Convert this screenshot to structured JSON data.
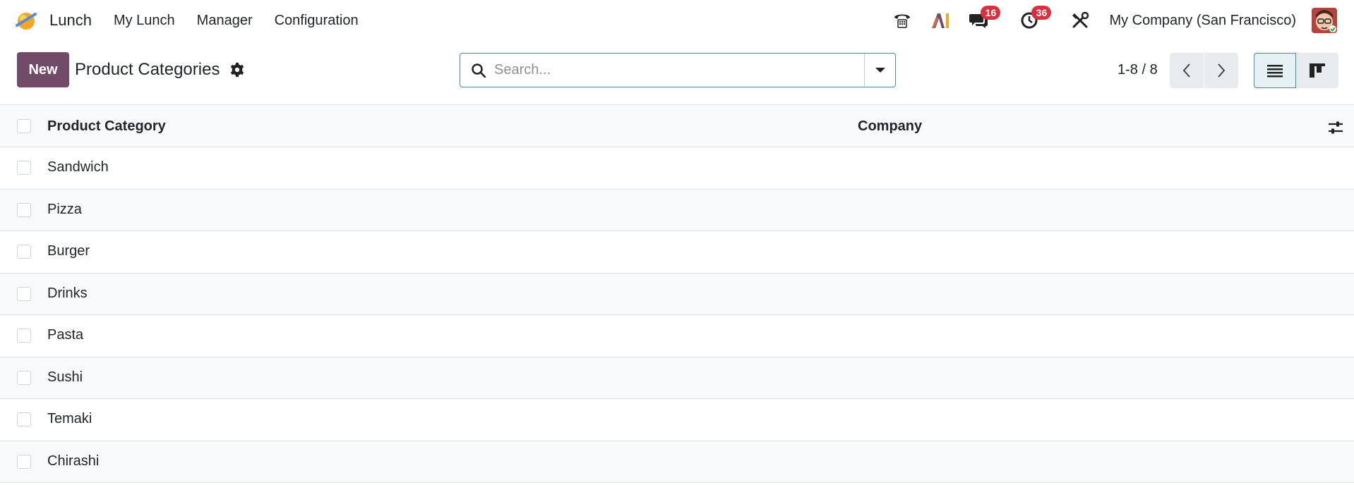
{
  "navbar": {
    "app_name": "Lunch",
    "menu": [
      "My Lunch",
      "Manager",
      "Configuration"
    ],
    "messages_count": "16",
    "activities_count": "36",
    "company": "My Company (San Francisco)"
  },
  "control_panel": {
    "new_label": "New",
    "title": "Product Categories",
    "search_placeholder": "Search...",
    "pager": "1-8 / 8"
  },
  "table": {
    "headers": {
      "category": "Product Category",
      "company": "Company"
    },
    "rows": [
      {
        "name": "Sandwich",
        "company": ""
      },
      {
        "name": "Pizza",
        "company": ""
      },
      {
        "name": "Burger",
        "company": ""
      },
      {
        "name": "Drinks",
        "company": ""
      },
      {
        "name": "Pasta",
        "company": ""
      },
      {
        "name": "Sushi",
        "company": ""
      },
      {
        "name": "Temaki",
        "company": ""
      },
      {
        "name": "Chirashi",
        "company": ""
      }
    ]
  },
  "colors": {
    "primary": "#714b67",
    "accent": "#3f8fa0",
    "badge": "#d9303e"
  }
}
